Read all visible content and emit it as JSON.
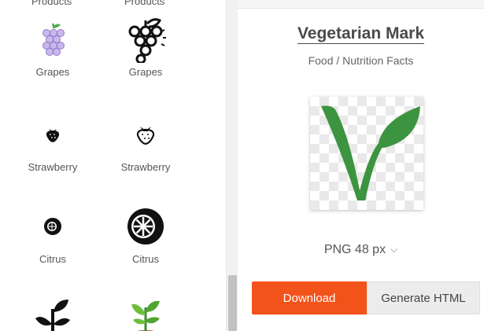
{
  "grid": {
    "top_labels": [
      "Products",
      "Products"
    ],
    "items": [
      {
        "label": "Grapes",
        "icon": "grapes-color-icon"
      },
      {
        "label": "Grapes",
        "icon": "grapes-outline-icon"
      },
      {
        "label": "Strawberry",
        "icon": "strawberry-solid-icon"
      },
      {
        "label": "Strawberry",
        "icon": "strawberry-outline-icon"
      },
      {
        "label": "Citrus",
        "icon": "citrus-solid-icon"
      },
      {
        "label": "Citrus",
        "icon": "citrus-glyph-icon"
      },
      {
        "label": "",
        "icon": "sprout-solid-icon"
      },
      {
        "label": "",
        "icon": "sprout-color-icon"
      }
    ]
  },
  "detail": {
    "title": "Vegetarian Mark",
    "category": "Food / Nutrition Facts",
    "preview_icon": "vegetarian-mark-icon",
    "size": "PNG 48 px",
    "download_label": "Download",
    "generate_html_label": "Generate HTML"
  },
  "colors": {
    "accent": "#f2531a",
    "leaf_green": "#3d9440",
    "grape_purple": "#b7a4e0"
  }
}
